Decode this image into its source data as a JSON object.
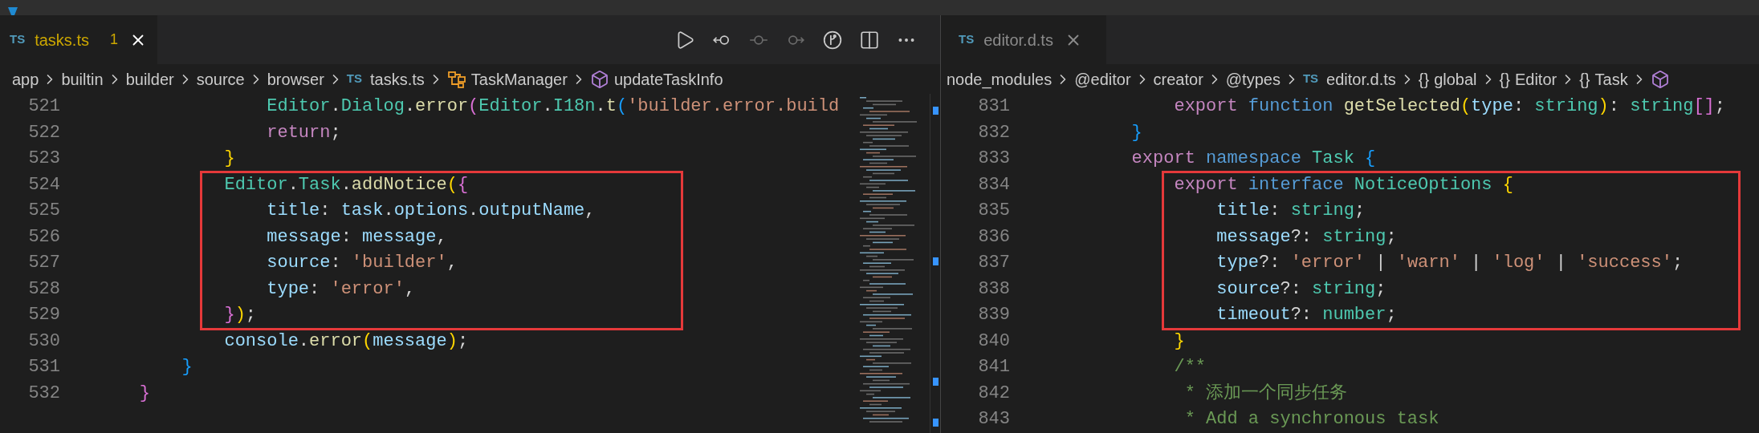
{
  "panes": [
    {
      "focused": true,
      "tab": {
        "icon_text": "TS",
        "label": "tasks.ts",
        "problems": "1",
        "selected": true
      },
      "toolbar": [
        {
          "kind": "run",
          "disabled": false
        },
        {
          "kind": "previous-change",
          "disabled": false
        },
        {
          "kind": "change",
          "disabled": true
        },
        {
          "kind": "next-change",
          "disabled": true
        },
        {
          "kind": "branch",
          "disabled": false
        },
        {
          "kind": "split",
          "disabled": false
        },
        {
          "kind": "more",
          "disabled": false
        }
      ],
      "breadcrumbs": [
        {
          "kind": "folder",
          "label": "app"
        },
        {
          "kind": "folder",
          "label": "builtin"
        },
        {
          "kind": "folder",
          "label": "builder"
        },
        {
          "kind": "folder",
          "label": "source"
        },
        {
          "kind": "folder",
          "label": "browser"
        },
        {
          "kind": "file",
          "icon_text": "TS",
          "label": "tasks.ts"
        },
        {
          "kind": "class",
          "label": "TaskManager"
        },
        {
          "kind": "method",
          "label": "updateTaskInfo"
        }
      ],
      "lines": [
        {
          "number": "521",
          "boxed": false,
          "tokens": [
            {
              "kind": "class",
              "text": "                Editor"
            },
            {
              "kind": "plain",
              "text": "."
            },
            {
              "kind": "class",
              "text": "Dialog"
            },
            {
              "kind": "plain",
              "text": "."
            },
            {
              "kind": "func",
              "text": "error"
            },
            {
              "kind": "b2",
              "text": "("
            },
            {
              "kind": "class",
              "text": "Editor"
            },
            {
              "kind": "plain",
              "text": "."
            },
            {
              "kind": "class",
              "text": "I18n"
            },
            {
              "kind": "plain",
              "text": "."
            },
            {
              "kind": "func",
              "text": "t"
            },
            {
              "kind": "b3",
              "text": "("
            },
            {
              "kind": "string",
              "text": "'builder.error.build"
            }
          ]
        },
        {
          "number": "522",
          "boxed": false,
          "tokens": [
            {
              "kind": "keyword",
              "text": "                return"
            },
            {
              "kind": "plain",
              "text": ";"
            }
          ]
        },
        {
          "number": "523",
          "boxed": false,
          "tokens": [
            {
              "kind": "b1",
              "text": "            }"
            }
          ]
        },
        {
          "number": "524",
          "boxed": true,
          "tokens": [
            {
              "kind": "class",
              "text": "            Editor"
            },
            {
              "kind": "plain",
              "text": "."
            },
            {
              "kind": "class",
              "text": "Task"
            },
            {
              "kind": "plain",
              "text": "."
            },
            {
              "kind": "func",
              "text": "addNotice"
            },
            {
              "kind": "b1",
              "text": "("
            },
            {
              "kind": "b2",
              "text": "{"
            }
          ]
        },
        {
          "number": "525",
          "boxed": true,
          "tokens": [
            {
              "kind": "prop",
              "text": "                title"
            },
            {
              "kind": "plain",
              "text": ": "
            },
            {
              "kind": "prop",
              "text": "task"
            },
            {
              "kind": "plain",
              "text": "."
            },
            {
              "kind": "prop",
              "text": "options"
            },
            {
              "kind": "plain",
              "text": "."
            },
            {
              "kind": "prop",
              "text": "outputName"
            },
            {
              "kind": "plain",
              "text": ","
            }
          ]
        },
        {
          "number": "526",
          "boxed": true,
          "tokens": [
            {
              "kind": "prop",
              "text": "                message"
            },
            {
              "kind": "plain",
              "text": ": "
            },
            {
              "kind": "prop",
              "text": "message"
            },
            {
              "kind": "plain",
              "text": ","
            }
          ]
        },
        {
          "number": "527",
          "boxed": true,
          "tokens": [
            {
              "kind": "prop",
              "text": "                source"
            },
            {
              "kind": "plain",
              "text": ": "
            },
            {
              "kind": "string",
              "text": "'builder'"
            },
            {
              "kind": "plain",
              "text": ","
            }
          ]
        },
        {
          "number": "528",
          "boxed": true,
          "tokens": [
            {
              "kind": "prop",
              "text": "                type"
            },
            {
              "kind": "plain",
              "text": ": "
            },
            {
              "kind": "string",
              "text": "'error'"
            },
            {
              "kind": "plain",
              "text": ","
            }
          ]
        },
        {
          "number": "529",
          "boxed": true,
          "tokens": [
            {
              "kind": "b2",
              "text": "            }"
            },
            {
              "kind": "b1",
              "text": ")"
            },
            {
              "kind": "plain",
              "text": ";"
            }
          ]
        },
        {
          "number": "530",
          "boxed": false,
          "tokens": [
            {
              "kind": "prop",
              "text": "            console"
            },
            {
              "kind": "plain",
              "text": "."
            },
            {
              "kind": "func",
              "text": "error"
            },
            {
              "kind": "b1",
              "text": "("
            },
            {
              "kind": "prop",
              "text": "message"
            },
            {
              "kind": "b1",
              "text": ")"
            },
            {
              "kind": "plain",
              "text": ";"
            }
          ]
        },
        {
          "number": "531",
          "boxed": false,
          "tokens": [
            {
              "kind": "b3",
              "text": "        }"
            }
          ]
        },
        {
          "number": "532",
          "boxed": false,
          "tokens": [
            {
              "kind": "b2",
              "text": "    }"
            }
          ]
        }
      ]
    },
    {
      "focused": false,
      "tab": {
        "icon_text": "TS",
        "label": "editor.d.ts",
        "selected": true
      },
      "breadcrumbs": [
        {
          "kind": "folder",
          "label": "node_modules"
        },
        {
          "kind": "folder",
          "label": "@editor"
        },
        {
          "kind": "folder",
          "label": "creator"
        },
        {
          "kind": "folder",
          "label": "@types"
        },
        {
          "kind": "file",
          "icon_text": "TS",
          "label": "editor.d.ts"
        },
        {
          "kind": "namespace",
          "icon_text": "{}",
          "label": "global"
        },
        {
          "kind": "namespace",
          "icon_text": "{}",
          "label": "Editor"
        },
        {
          "kind": "namespace",
          "icon_text": "{}",
          "label": "Task"
        },
        {
          "kind": "method"
        }
      ],
      "lines": [
        {
          "number": "831",
          "boxed": false,
          "tokens": [
            {
              "kind": "keyword",
              "text": "            export"
            },
            {
              "kind": "storage",
              "text": " function"
            },
            {
              "kind": "func",
              "text": " getSelected"
            },
            {
              "kind": "b1",
              "text": "("
            },
            {
              "kind": "prop",
              "text": "type"
            },
            {
              "kind": "plain",
              "text": ": "
            },
            {
              "kind": "type",
              "text": "string"
            },
            {
              "kind": "b1",
              "text": ")"
            },
            {
              "kind": "plain",
              "text": ": "
            },
            {
              "kind": "type",
              "text": "string"
            },
            {
              "kind": "b2",
              "text": "[]"
            },
            {
              "kind": "plain",
              "text": ";"
            }
          ]
        },
        {
          "number": "832",
          "boxed": false,
          "tokens": [
            {
              "kind": "b3",
              "text": "        }"
            }
          ]
        },
        {
          "number": "833",
          "boxed": false,
          "tokens": [
            {
              "kind": "keyword",
              "text": "        export"
            },
            {
              "kind": "storage",
              "text": " namespace"
            },
            {
              "kind": "class",
              "text": " Task"
            },
            {
              "kind": "b3",
              "text": " {"
            }
          ]
        },
        {
          "number": "834",
          "boxed": true,
          "tokens": [
            {
              "kind": "keyword",
              "text": "            export"
            },
            {
              "kind": "storage",
              "text": " interface"
            },
            {
              "kind": "class",
              "text": " NoticeOptions"
            },
            {
              "kind": "b1",
              "text": " {"
            }
          ]
        },
        {
          "number": "835",
          "boxed": true,
          "tokens": [
            {
              "kind": "prop",
              "text": "                title"
            },
            {
              "kind": "plain",
              "text": ": "
            },
            {
              "kind": "type",
              "text": "string"
            },
            {
              "kind": "plain",
              "text": ";"
            }
          ]
        },
        {
          "number": "836",
          "boxed": true,
          "tokens": [
            {
              "kind": "prop",
              "text": "                message"
            },
            {
              "kind": "plain",
              "text": "?: "
            },
            {
              "kind": "type",
              "text": "string"
            },
            {
              "kind": "plain",
              "text": ";"
            }
          ]
        },
        {
          "number": "837",
          "boxed": true,
          "tokens": [
            {
              "kind": "prop",
              "text": "                type"
            },
            {
              "kind": "plain",
              "text": "?: "
            },
            {
              "kind": "string",
              "text": "'error'"
            },
            {
              "kind": "plain",
              "text": " | "
            },
            {
              "kind": "string",
              "text": "'warn'"
            },
            {
              "kind": "plain",
              "text": " | "
            },
            {
              "kind": "string",
              "text": "'log'"
            },
            {
              "kind": "plain",
              "text": " | "
            },
            {
              "kind": "string",
              "text": "'success'"
            },
            {
              "kind": "plain",
              "text": ";"
            }
          ]
        },
        {
          "number": "838",
          "boxed": true,
          "tokens": [
            {
              "kind": "prop",
              "text": "                source"
            },
            {
              "kind": "plain",
              "text": "?: "
            },
            {
              "kind": "type",
              "text": "string"
            },
            {
              "kind": "plain",
              "text": ";"
            }
          ]
        },
        {
          "number": "839",
          "boxed": true,
          "tokens": [
            {
              "kind": "prop",
              "text": "                timeout"
            },
            {
              "kind": "plain",
              "text": "?: "
            },
            {
              "kind": "type",
              "text": "number"
            },
            {
              "kind": "plain",
              "text": ";"
            }
          ]
        },
        {
          "number": "840",
          "boxed": false,
          "tokens": [
            {
              "kind": "b1",
              "text": "            }"
            }
          ]
        },
        {
          "number": "841",
          "boxed": false,
          "tokens": [
            {
              "kind": "comment",
              "text": "            /**"
            }
          ]
        },
        {
          "number": "842",
          "boxed": false,
          "tokens": [
            {
              "kind": "comment",
              "text": "             * 添加一个同步任务"
            }
          ]
        },
        {
          "number": "843",
          "boxed": false,
          "tokens": [
            {
              "kind": "comment",
              "text": "             * Add a synchronous task"
            }
          ]
        }
      ]
    }
  ]
}
